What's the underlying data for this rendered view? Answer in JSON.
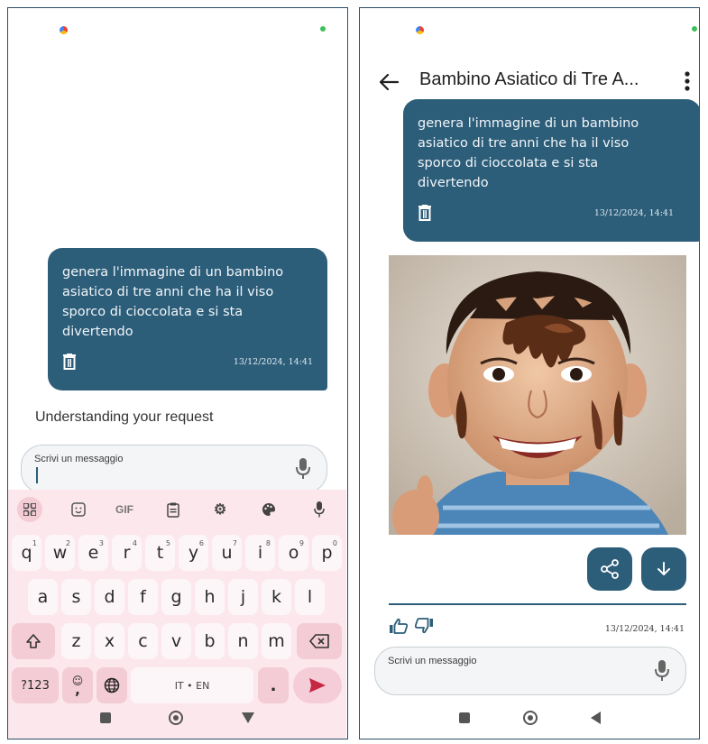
{
  "left_screen": {
    "user_message": {
      "text": "genera l'immagine di un bambino asiatico di tre anni che ha il viso sporco di cioccolata e si sta divertendo",
      "timestamp": "13/12/2024, 14:41"
    },
    "status_text": "Understanding your request",
    "input": {
      "placeholder": "Scrivi un messaggio"
    },
    "keyboard": {
      "toolbar": [
        "apps-icon",
        "sticker-icon",
        "GIF",
        "clipboard-icon",
        "settings-icon",
        "palette-icon",
        "mic-icon"
      ],
      "gif_label": "GIF",
      "row1": [
        {
          "key": "q",
          "hint": "1"
        },
        {
          "key": "w",
          "hint": "2"
        },
        {
          "key": "e",
          "hint": "3"
        },
        {
          "key": "r",
          "hint": "4"
        },
        {
          "key": "t",
          "hint": "5"
        },
        {
          "key": "y",
          "hint": "6"
        },
        {
          "key": "u",
          "hint": "7"
        },
        {
          "key": "i",
          "hint": "8"
        },
        {
          "key": "o",
          "hint": "9"
        },
        {
          "key": "p",
          "hint": "0"
        }
      ],
      "row2": [
        "a",
        "s",
        "d",
        "f",
        "g",
        "h",
        "j",
        "k",
        "l"
      ],
      "row3": [
        "z",
        "x",
        "c",
        "v",
        "b",
        "n",
        "m"
      ],
      "numbers_key": "?123",
      "emoji_key": ",",
      "space_label": "IT • EN",
      "period_key": "."
    }
  },
  "right_screen": {
    "header": {
      "title": "Bambino Asiatico di Tre A..."
    },
    "user_message": {
      "text": "genera l'immagine di un bambino asiatico di tre anni che ha il viso sporco di cioccolata e si sta divertendo",
      "timestamp": "13/12/2024, 14:41"
    },
    "reply": {
      "timestamp": "13/12/2024, 14:41"
    },
    "input": {
      "placeholder": "Scrivi un messaggio"
    }
  },
  "colors": {
    "accent": "#2c5d79",
    "keyboard_bg": "#fce7ec",
    "enter_key": "#c62844"
  }
}
